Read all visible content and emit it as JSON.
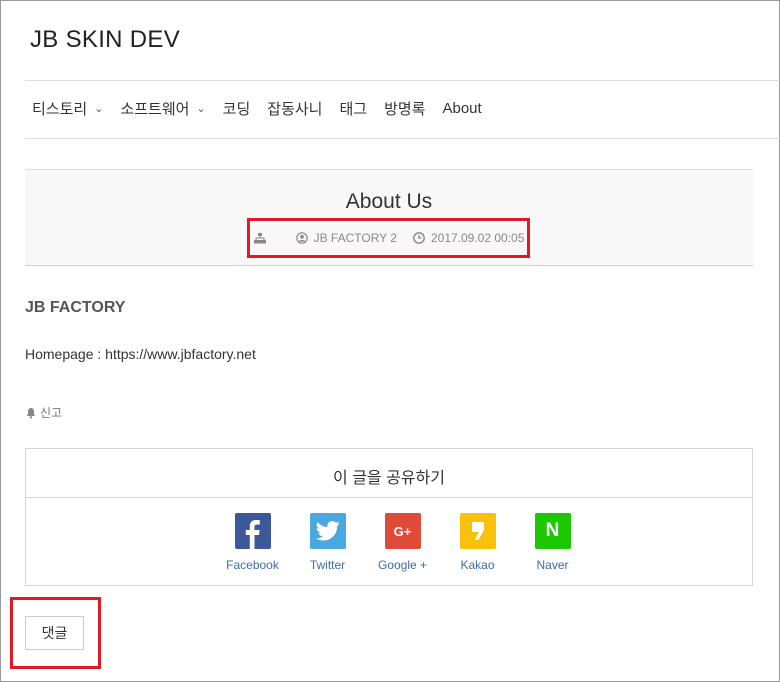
{
  "site": {
    "title": "JB SKIN DEV"
  },
  "nav": {
    "items": [
      {
        "label": "티스토리",
        "dropdown": true
      },
      {
        "label": "소프트웨어",
        "dropdown": true
      },
      {
        "label": "코딩"
      },
      {
        "label": "잡동사니"
      },
      {
        "label": "태그"
      },
      {
        "label": "방명록"
      },
      {
        "label": "About"
      }
    ]
  },
  "post": {
    "title": "About Us",
    "author": "JB FACTORY 2",
    "date": "2017.09.02 00:05"
  },
  "content": {
    "heading": "JB FACTORY",
    "homepage": "Homepage : https://www.jbfactory.net"
  },
  "report": {
    "label": "신고"
  },
  "share": {
    "title": "이 글을 공유하기",
    "buttons": [
      {
        "label": "Facebook",
        "icon": "facebook-icon",
        "color": "#3b5998"
      },
      {
        "label": "Twitter",
        "icon": "twitter-icon",
        "color": "#4aa8e0"
      },
      {
        "label": "Google +",
        "icon": "google-plus-icon",
        "color": "#dd4b39"
      },
      {
        "label": "Kakao",
        "icon": "kakao-icon",
        "color": "#f9c00c"
      },
      {
        "label": "Naver",
        "icon": "naver-icon",
        "color": "#1ec800"
      }
    ]
  },
  "comments": {
    "label": "댓글"
  },
  "colors": {
    "highlight": "#e01b24",
    "link": "#3a6ea5",
    "header_bg": "#f8f8f8"
  }
}
